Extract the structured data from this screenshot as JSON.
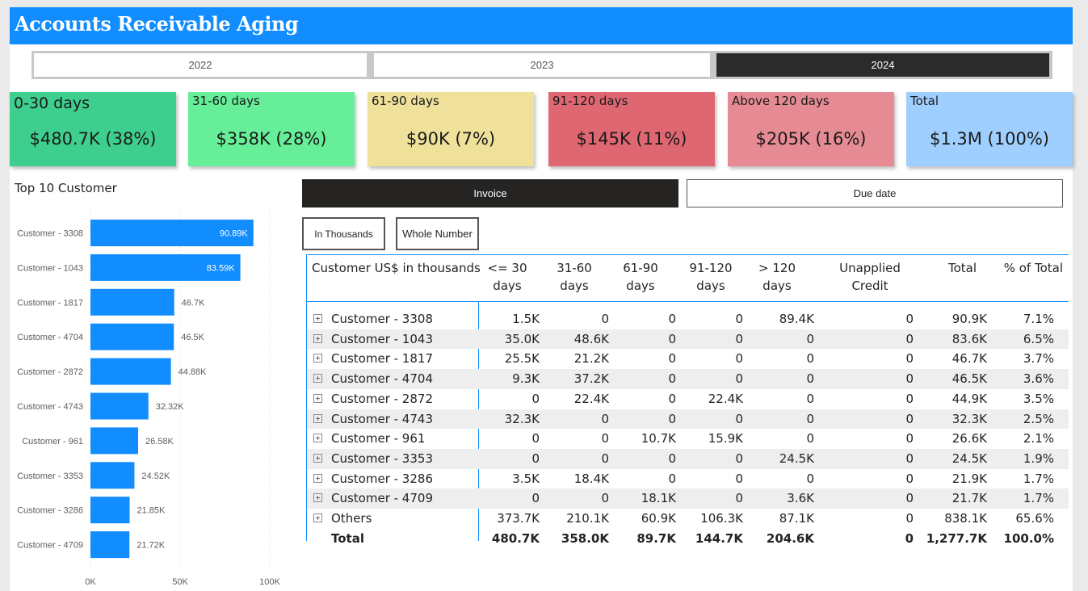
{
  "header": {
    "title": "Accounts Receivable Aging"
  },
  "years": [
    {
      "label": "2022",
      "selected": false
    },
    {
      "label": "2023",
      "selected": false
    },
    {
      "label": "2024",
      "selected": true
    }
  ],
  "kpis": [
    {
      "label": "0-30 days",
      "value": "$480.7K (38%)",
      "color": "#3ecf8e"
    },
    {
      "label": "31-60 days",
      "value": "$358K (28%)",
      "color": "#66ef98"
    },
    {
      "label": "61-90 days",
      "value": "$90K (7%)",
      "color": "#efe09a"
    },
    {
      "label": "91-120 days",
      "value": "$145K (11%)",
      "color": "#df6771"
    },
    {
      "label": "Above 120 days",
      "value": "$205K (16%)",
      "color": "#e68b93"
    },
    {
      "label": "Total",
      "value": "$1.3M (100%)",
      "color": "#9ecfff"
    }
  ],
  "bar_chart_title": "Top 10 Customer",
  "chart_data": {
    "type": "bar",
    "orientation": "horizontal",
    "title": "Top 10 Customer",
    "categories": [
      "Customer - 3308",
      "Customer - 1043",
      "Customer - 1817",
      "Customer - 4704",
      "Customer - 2872",
      "Customer - 4743",
      "Customer - 961",
      "Customer - 3353",
      "Customer - 3286",
      "Customer - 4709"
    ],
    "values": [
      90890,
      83590,
      46700,
      46500,
      44880,
      32320,
      26580,
      24520,
      21850,
      21720
    ],
    "data_labels": [
      "90.89K",
      "83.59K",
      "46.7K",
      "46.5K",
      "44.88K",
      "32.32K",
      "26.58K",
      "24.52K",
      "21.85K",
      "21.72K"
    ],
    "x_ticks": [
      0,
      50000,
      100000
    ],
    "x_tick_labels": [
      "0K",
      "50K",
      "100K"
    ],
    "xlim": [
      0,
      100000
    ],
    "bar_color": "#118dff",
    "grid": true,
    "xlabel": "",
    "ylabel": ""
  },
  "toggles": {
    "invoice": "Invoice",
    "due_date": "Due date",
    "in_thousands": "In Thousands",
    "whole_number": "Whole Number"
  },
  "matrix": {
    "headers": [
      "Customer US$ in thousands",
      "<= 30\ndays",
      "31-60\ndays",
      "61-90\ndays",
      "91-120\ndays",
      "> 120\ndays",
      "Unapplied\nCredit",
      "Total",
      "% of Total"
    ],
    "rows": [
      [
        "Customer - 3308",
        "1.5K",
        "0",
        "0",
        "0",
        "89.4K",
        "0",
        "90.9K",
        "7.1%"
      ],
      [
        "Customer - 1043",
        "35.0K",
        "48.6K",
        "0",
        "0",
        "0",
        "0",
        "83.6K",
        "6.5%"
      ],
      [
        "Customer - 1817",
        "25.5K",
        "21.2K",
        "0",
        "0",
        "0",
        "0",
        "46.7K",
        "3.7%"
      ],
      [
        "Customer - 4704",
        "9.3K",
        "37.2K",
        "0",
        "0",
        "0",
        "0",
        "46.5K",
        "3.6%"
      ],
      [
        "Customer - 2872",
        "0",
        "22.4K",
        "0",
        "22.4K",
        "0",
        "0",
        "44.9K",
        "3.5%"
      ],
      [
        "Customer - 4743",
        "32.3K",
        "0",
        "0",
        "0",
        "0",
        "0",
        "32.3K",
        "2.5%"
      ],
      [
        "Customer - 961",
        "0",
        "0",
        "10.7K",
        "15.9K",
        "0",
        "0",
        "26.6K",
        "2.1%"
      ],
      [
        "Customer - 3353",
        "0",
        "0",
        "0",
        "0",
        "24.5K",
        "0",
        "24.5K",
        "1.9%"
      ],
      [
        "Customer - 3286",
        "3.5K",
        "18.4K",
        "0",
        "0",
        "0",
        "0",
        "21.9K",
        "1.7%"
      ],
      [
        "Customer - 4709",
        "0",
        "0",
        "18.1K",
        "0",
        "3.6K",
        "0",
        "21.7K",
        "1.7%"
      ],
      [
        "Others",
        "373.7K",
        "210.1K",
        "60.9K",
        "106.3K",
        "87.1K",
        "0",
        "838.1K",
        "65.6%"
      ]
    ],
    "total": [
      "Total",
      "480.7K",
      "358.0K",
      "89.7K",
      "144.7K",
      "204.6K",
      "0",
      "1,277.7K",
      "100.0%"
    ]
  }
}
